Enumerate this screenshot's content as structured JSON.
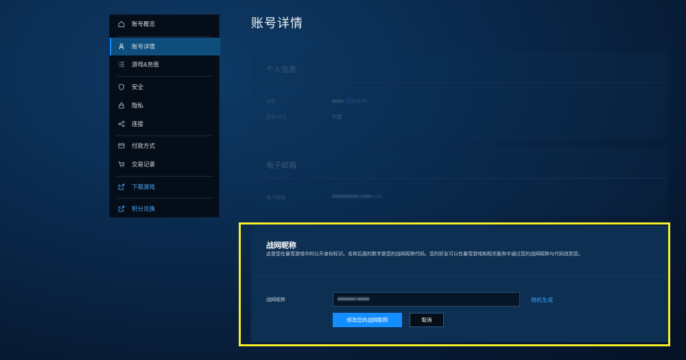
{
  "sidebar": {
    "items": [
      {
        "label": "账号概览",
        "icon": "home-icon"
      },
      {
        "label": "账号详情",
        "icon": "person-icon",
        "active": true
      },
      {
        "label": "游戏&充值",
        "icon": "list-icon"
      },
      {
        "label": "安全",
        "icon": "shield-icon"
      },
      {
        "label": "隐私",
        "icon": "lock-icon"
      },
      {
        "label": "连接",
        "icon": "share-icon"
      },
      {
        "label": "付款方式",
        "icon": "card-icon"
      },
      {
        "label": "交易记录",
        "icon": "cart-icon"
      },
      {
        "label": "下载游戏",
        "icon": "external-link-icon",
        "link": true
      },
      {
        "label": "积分兑换",
        "icon": "external-link-icon",
        "link": true
      }
    ]
  },
  "page": {
    "title": "账号详情"
  },
  "personal_info": {
    "title": "个人信息",
    "name_label": "名称",
    "name_value": "■■■■",
    "name_edit": "(更新名称)",
    "country_label": "国家/地区",
    "country_value": "中国"
  },
  "email": {
    "title": "电子邮箱",
    "label": "电子邮箱",
    "value": "■■■■■■■■■@■■■.com"
  },
  "battletag": {
    "title": "战网昵称",
    "description": "这是您在暴雪游戏中的公开身份标识。名称后面的数字是您的战网昵称代码。您的好友可以在暴雪游戏和相关服务中通过您的战网昵称与代码找到您。",
    "field_label": "战网昵称",
    "input_value": "■■■■■■#■■■■",
    "random_label": "随机生成",
    "submit_label": "修改您的战网昵称",
    "cancel_label": "取消"
  },
  "colors": {
    "accent": "#148eff",
    "highlight": "#f5f02b",
    "link": "#4ea9ff"
  }
}
